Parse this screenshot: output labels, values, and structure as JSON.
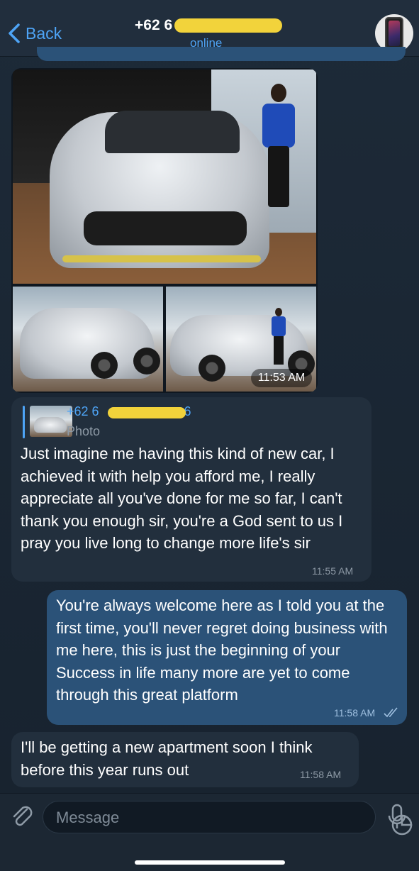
{
  "header": {
    "back_label": "Back",
    "contact_title": "+62 6",
    "status": "online"
  },
  "photo_message": {
    "time": "11:53 AM"
  },
  "messages": [
    {
      "direction": "incoming",
      "reply_to": {
        "name_prefix": "+62 6",
        "name_suffix": "6",
        "type": "Photo"
      },
      "text": "Just imagine me having this kind of new car, I achieved it with help you afford me, I really appreciate all you've done for me so far, I can't thank you enough sir, you're a God sent to us I pray you live long to change more life's sir",
      "time": "11:55 AM"
    },
    {
      "direction": "outgoing",
      "text": "You're always welcome here as I told you at the first time, you'll never regret doing business with me here, this is just the beginning of your Success in life many more are yet to come through this great platform",
      "time": "11:58 AM"
    },
    {
      "direction": "incoming",
      "text": "I'll be getting a new apartment soon I think before this year runs out",
      "time": "11:58 AM"
    }
  ],
  "composer": {
    "placeholder": "Message"
  },
  "colors": {
    "accent": "#4ea4f6",
    "incoming_bubble": "#222f3d",
    "outgoing_bubble": "#2b5278",
    "redaction": "#f2d33b"
  }
}
